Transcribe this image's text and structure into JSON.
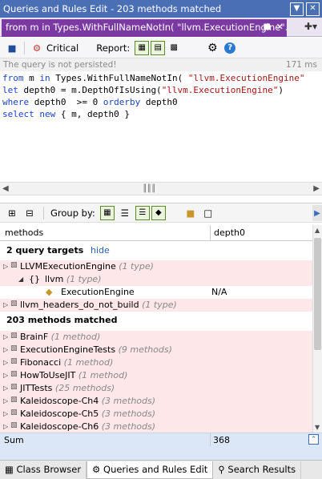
{
  "window": {
    "title": "Queries and Rules Edit  -  203 methods matched"
  },
  "tab": {
    "label": "from m in Types.WithFullNameNotIn( \"llvm.ExecutionEngine\"..."
  },
  "toolbar": {
    "critical_label": "Critical",
    "report_label": "Report:"
  },
  "status": {
    "message": "The query is not persisted!",
    "time": "171 ms"
  },
  "editor": {
    "line1": {
      "k1": "from",
      "a": " m ",
      "k2": "in",
      "b": " Types.WithFullNameNotIn( ",
      "s": "\"llvm.ExecutionEngine\""
    },
    "line2": {
      "k1": "let",
      "a": " depth0 = m.DepthOfIsUsing(",
      "s": "\"llvm.ExecutionEngine\"",
      "b": ")"
    },
    "line3": {
      "k1": "where",
      "a": " depth0  >= ",
      "n": "0",
      "b": " ",
      "k2": "orderby",
      "c": " depth0"
    },
    "line4": {
      "k1": "select",
      "a": " ",
      "k2": "new",
      "b": " { m, depth0 }"
    }
  },
  "groupbar": {
    "label": "Group by:"
  },
  "grid": {
    "headers": {
      "col1": "methods",
      "col2": "depth0"
    },
    "section1": {
      "title": "2 query targets",
      "link": "hide"
    },
    "targets": [
      {
        "name": "LLVMExecutionEngine",
        "note": "(1 type)"
      },
      {
        "name": "llvm",
        "note": "(1 type)"
      },
      {
        "name": "ExecutionEngine",
        "value": "N/A"
      },
      {
        "name": "llvm_headers_do_not_build",
        "note": "(1 type)"
      }
    ],
    "section2": {
      "title": "203 methods matched"
    },
    "methods": [
      {
        "name": "BrainF",
        "note": "(1 method)"
      },
      {
        "name": "ExecutionEngineTests",
        "note": "(9 methods)"
      },
      {
        "name": "Fibonacci",
        "note": "(1 method)"
      },
      {
        "name": "HowToUseJIT",
        "note": "(1 method)"
      },
      {
        "name": "JITTests",
        "note": "(25 methods)"
      },
      {
        "name": "Kaleidoscope-Ch4",
        "note": "(3 methods)"
      },
      {
        "name": "Kaleidoscope-Ch5",
        "note": "(3 methods)"
      },
      {
        "name": "Kaleidoscope-Ch6",
        "note": "(3 methods)"
      }
    ],
    "sum": {
      "label": "Sum",
      "value": "368"
    }
  },
  "bottom_tabs": [
    {
      "label": "Class Browser"
    },
    {
      "label": "Queries and Rules Edit"
    },
    {
      "label": "Search Results"
    }
  ],
  "colors": {
    "title_bg": "#4a6fb5",
    "tab_active": "#7a3aa1",
    "row_highlight": "#fde7e9",
    "sum_bg": "#dbe6f7",
    "keyword": "#1b44c4",
    "string": "#a31515"
  }
}
